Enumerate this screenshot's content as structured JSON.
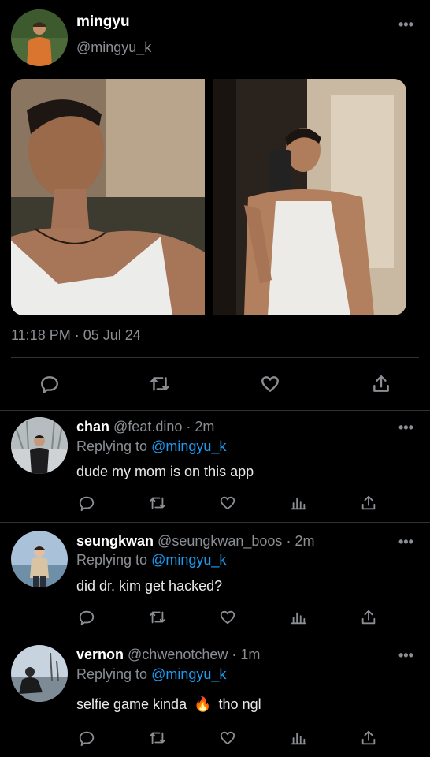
{
  "tweet": {
    "author_name": "mingyu",
    "author_handle": "@mingyu_k",
    "timestamp": "11:18 PM · 05 Jul 24",
    "more_icon": "more-horizontal-icon"
  },
  "replies": [
    {
      "name": "chan",
      "handle": "@feat.dino",
      "time": "· 2m",
      "replying_prefix": "Replying to",
      "replying_to": "@mingyu_k",
      "text": "dude my mom is on this app"
    },
    {
      "name": "seungkwan",
      "handle": "@seungkwan_boos",
      "time": "· 2m",
      "replying_prefix": "Replying to",
      "replying_to": "@mingyu_k",
      "text": "did dr. kim get hacked?"
    },
    {
      "name": "vernon",
      "handle": "@chwenotchew",
      "time": "· 1m",
      "replying_prefix": "Replying to",
      "replying_to": "@mingyu_k",
      "text_before": "selfie game kinda",
      "emoji": "🔥",
      "text_after": "tho ngl"
    }
  ],
  "icons": [
    "reply-icon",
    "retweet-icon",
    "like-icon",
    "views-icon",
    "share-icon"
  ],
  "colors": {
    "background": "#000000",
    "text": "#e7e9ea",
    "secondary": "#8b8f94",
    "link": "#1d9bf0",
    "divider": "#2f3336"
  }
}
